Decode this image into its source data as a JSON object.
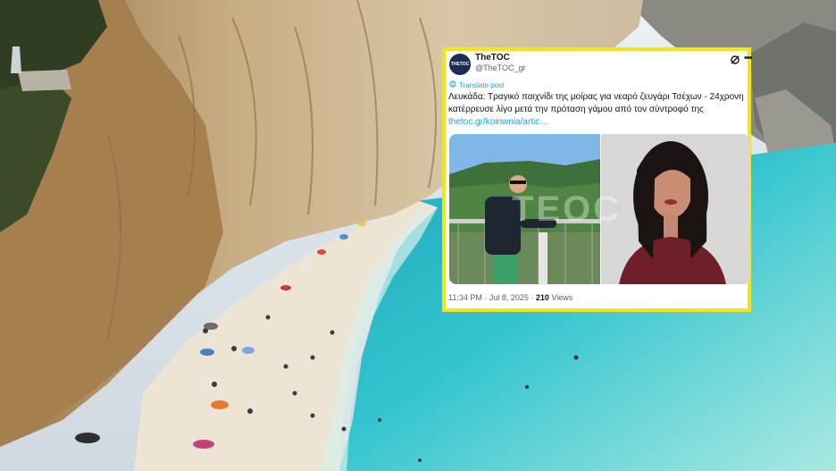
{
  "tweet": {
    "display_name": "TheTOC",
    "handle": "@TheTOC_gr",
    "avatar_text": "THETOC",
    "translate_label": "Translate post",
    "text": "Λευκάδα: Τραγικό παιχνίδι της μοίρας για νεαρό ζευγάρι Τσέχων - 24χρονη κατέρρευσε λίγο μετά την πρόταση γάμου από τον σύντροφό της ",
    "link_text": "thetoc.gr/koinwnia/artic…",
    "media_watermark": "TEOC",
    "timestamp": "11:34 PM · Jul 8, 2025 · ",
    "views_count": "210",
    "views_label": " Views",
    "icons": [
      "grok-icon",
      "more-icon",
      "translate-icon"
    ]
  },
  "colors": {
    "highlight_border": "#f3e51b",
    "link": "#1d9bf0",
    "sea": "#33c3cf"
  }
}
